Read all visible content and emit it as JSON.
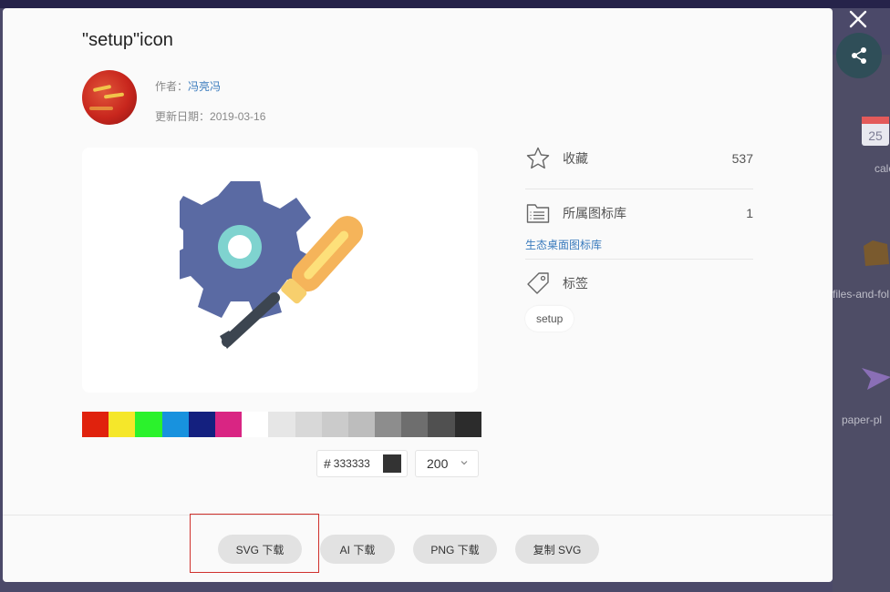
{
  "modal": {
    "title": "\"setup\"icon",
    "author_label": "作者：",
    "author_name": "冯亮冯",
    "updated_label": "更新日期：",
    "updated_date": "2019-03-16"
  },
  "color_picker": {
    "swatches": [
      "#e0220d",
      "#f5e72a",
      "#2bf22c",
      "#1892de",
      "#14207f",
      "#d92583",
      "#ffffff",
      "#e6e6e6",
      "#d8d8d8",
      "#cbcbcb",
      "#bdbdbd",
      "#8d8d8d",
      "#6e6e6e",
      "#505050",
      "#2c2c2c"
    ],
    "hash": "#",
    "hex_value": "333333",
    "selected_color": "#333333",
    "size_value": "200"
  },
  "sidebar": {
    "favorite_label": "收藏",
    "favorite_count": "537",
    "library_label": "所属图标库",
    "library_count": "1",
    "library_name": "生态桌面图标库",
    "tags_label": "标签",
    "tag": "setup"
  },
  "footer": {
    "svg_download": "SVG 下载",
    "ai_download": "AI 下载",
    "png_download": "PNG 下载",
    "copy_svg": "复制 SVG"
  },
  "background": {
    "thumbs": [
      "calendar",
      "files-and-fol",
      "paper-pl"
    ]
  },
  "colors": {
    "gear": "#5a6aa3",
    "gear_hub": "#7fd3cf",
    "handle": "#f5b45a",
    "handle_light": "#fde07a",
    "shaft": "#3c4550",
    "link": "#3a7bbd"
  },
  "icons": [
    "close-icon",
    "share-icon",
    "star-icon",
    "library-icon",
    "tag-icon",
    "chevron-down-icon"
  ]
}
